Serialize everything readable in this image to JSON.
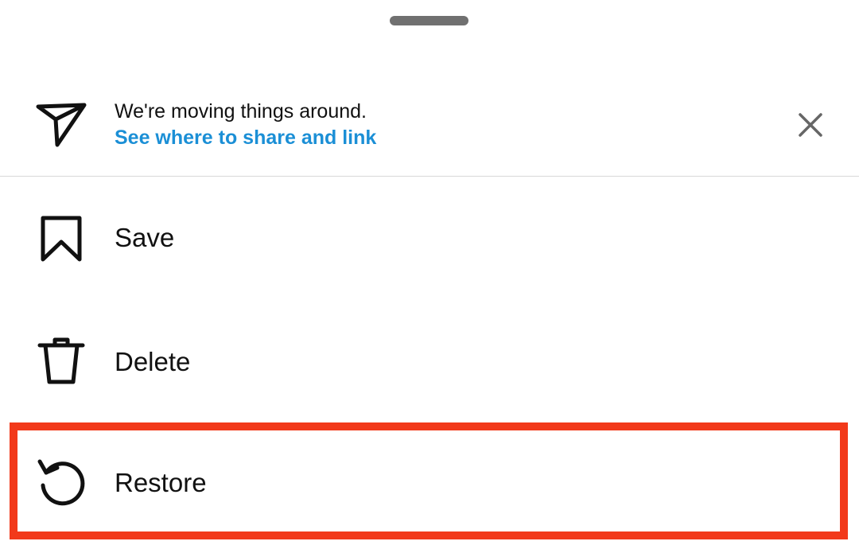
{
  "notice": {
    "line1": "We're moving things around.",
    "link": "See where to share and link",
    "icon": "paper-plane-icon",
    "close_icon": "close-icon"
  },
  "menu": {
    "items": [
      {
        "label": "Save",
        "icon": "bookmark-icon"
      },
      {
        "label": "Delete",
        "icon": "trash-icon"
      },
      {
        "label": "Restore",
        "icon": "restore-icon"
      }
    ]
  },
  "colors": {
    "link": "#1b8fd6",
    "highlight": "#f2391a",
    "handle": "#707070",
    "divider": "#d8d8d8",
    "text": "#111111"
  }
}
